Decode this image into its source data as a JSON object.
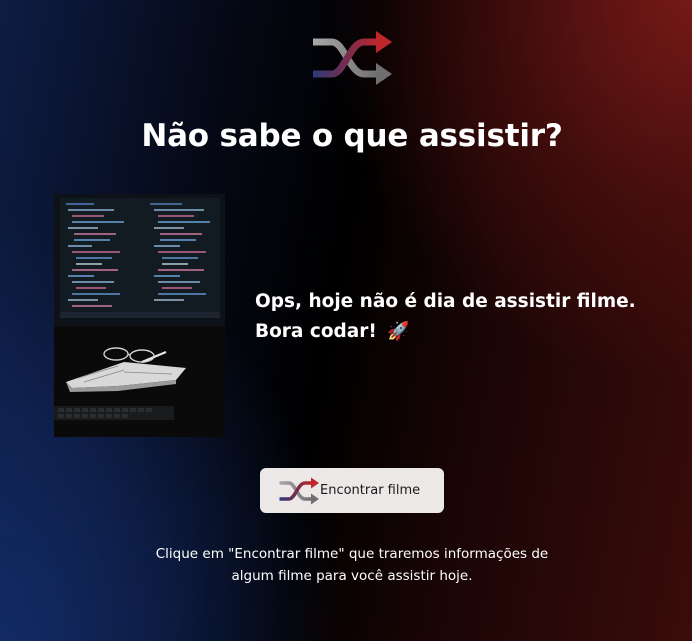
{
  "header": {
    "logo_icon": "shuffle-icon",
    "title": "Não sabe o que assistir?"
  },
  "movie": {
    "poster_image": "laptop-code-image",
    "message_line1": "Ops, hoje não é dia de assistir filme.",
    "message_line2": "Bora codar!",
    "message_emoji": "🚀"
  },
  "action": {
    "button_icon": "shuffle-icon",
    "button_label": "Encontrar filme"
  },
  "footer": {
    "hint": "Clique em \"Encontrar filme\" que traremos informações de algum filme para você assistir hoje."
  },
  "colors": {
    "shuffle_red": "#c0272d",
    "shuffle_blue": "#2b3a7a",
    "shuffle_gray": "#8a8a8a",
    "button_bg": "#ece8e7"
  }
}
